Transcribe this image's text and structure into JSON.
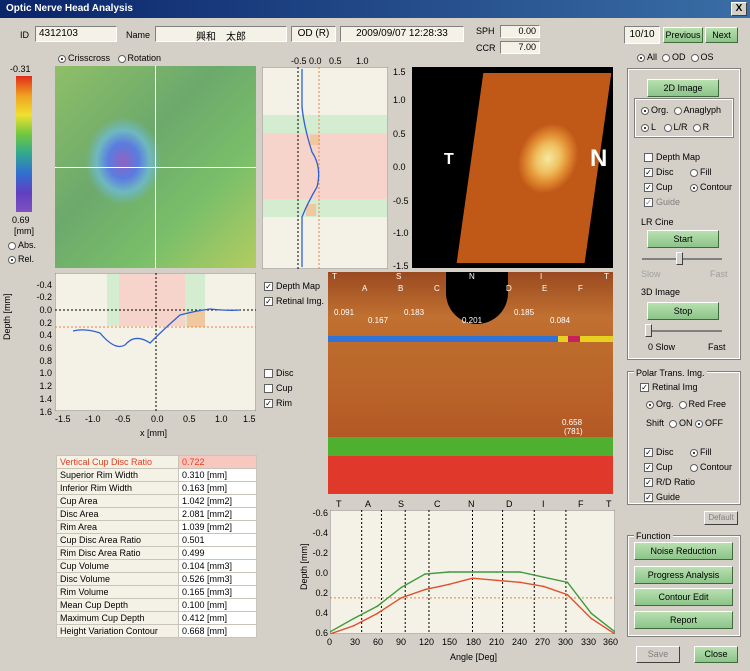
{
  "window": {
    "title": "Optic Nerve Head Analysis",
    "close_glyph": "X"
  },
  "header": {
    "id_label": "ID",
    "id_value": "4312103",
    "name_label": "Name",
    "name_value": "興和　太郎",
    "eye_value": "OD (R)",
    "datetime_value": "2009/09/07 12:28:33",
    "sph_label": "SPH",
    "sph_value": "0.00",
    "ccr_label": "CCR",
    "ccr_value": "7.00"
  },
  "nav": {
    "page_counter": "10/10",
    "previous_label": "Previous",
    "next_label": "Next",
    "filter_all": "All",
    "filter_od": "OD",
    "filter_os": "OS"
  },
  "view_mode": {
    "crisscross": "Crisscross",
    "rotation": "Rotation"
  },
  "colorbar": {
    "top": "-0.31",
    "bottom": "0.69",
    "unit": "[mm]",
    "abs": "Abs.",
    "rel": "Rel."
  },
  "vertical_profile": {
    "ticks_top": [
      "-0.5",
      "0.0",
      "0.5",
      "1.0"
    ],
    "ticks_right": [
      "1.5",
      "1.0",
      "0.5",
      "0.0",
      "-0.5",
      "-1.0",
      "-1.5"
    ]
  },
  "image_3d": {
    "label_t": "T",
    "label_n": "N"
  },
  "horizontal_profile": {
    "ylabel": "Depth [mm]",
    "xlabel": "x [mm]",
    "yticks": [
      "-0.4",
      "-0.2",
      "0.0",
      "0.2",
      "0.4",
      "0.6",
      "0.8",
      "1.0",
      "1.2",
      "1.4",
      "1.6"
    ],
    "xticks": [
      "-1.5",
      "-1.0",
      "-0.5",
      "0.0",
      "0.5",
      "1.0",
      "1.5"
    ]
  },
  "overlay_checks": {
    "depth_map": "Depth Map",
    "retinal_img": "Retinal Img.",
    "disc": "Disc",
    "cup": "Cup",
    "rim": "Rim"
  },
  "polar": {
    "sector_letters": [
      "T",
      "A",
      "S",
      "B",
      "C",
      "N",
      "D",
      "I",
      "E",
      "F",
      "T"
    ],
    "ratios": [
      "0.091",
      "0.167",
      "0.183",
      "0.201",
      "0.185",
      "0.084"
    ],
    "right_value": "0.658",
    "right_value2": "(781)"
  },
  "polar_chart": {
    "ylabel": "Depth [mm]",
    "xlabel": "Angle [Deg]",
    "yticks": [
      "-0.6",
      "-0.4",
      "-0.2",
      "0.0",
      "0.2",
      "0.4",
      "0.6"
    ],
    "xticks": [
      "0",
      "30",
      "60",
      "90",
      "120",
      "150",
      "180",
      "210",
      "240",
      "270",
      "300",
      "330",
      "360"
    ],
    "top_letters": [
      "T",
      "A",
      "S",
      "C",
      "N",
      "D",
      "I",
      "F",
      "T"
    ]
  },
  "measurements": [
    {
      "k": "Vertical Cup Disc Ratio",
      "v": "0.722",
      "hl": true
    },
    {
      "k": "Superior Rim Width",
      "v": "0.310 [mm]"
    },
    {
      "k": "Inferior Rim Width",
      "v": "0.163 [mm]"
    },
    {
      "k": "Cup Area",
      "v": "1.042 [mm2]"
    },
    {
      "k": "Disc Area",
      "v": "2.081 [mm2]"
    },
    {
      "k": "Rim Area",
      "v": "1.039 [mm2]"
    },
    {
      "k": "Cup Disc Area Ratio",
      "v": "0.501"
    },
    {
      "k": "Rim Disc Area Ratio",
      "v": "0.499"
    },
    {
      "k": "Cup Volume",
      "v": "0.104 [mm3]"
    },
    {
      "k": "Disc Volume",
      "v": "0.526 [mm3]"
    },
    {
      "k": "Rim Volume",
      "v": "0.165 [mm3]"
    },
    {
      "k": "Mean Cup Depth",
      "v": "0.100 [mm]"
    },
    {
      "k": "Maximum Cup Depth",
      "v": "0.412 [mm]"
    },
    {
      "k": "Height Variation Contour",
      "v": "0.668 [mm]"
    }
  ],
  "right_panel": {
    "btn_2d": "2D Image",
    "org": "Org.",
    "anaglyph": "Anaglyph",
    "l": "L",
    "lr": "L/R",
    "r": "R",
    "depth_map": "Depth Map",
    "disc": "Disc",
    "fill": "Fill",
    "cup": "Cup",
    "contour": "Contour",
    "guide": "Guide",
    "lr_cine": "LR Cine",
    "start": "Start",
    "slow": "Slow",
    "fast": "Fast",
    "image_3d": "3D Image",
    "stop": "Stop",
    "zero_slow": "0  Slow",
    "fast2": "Fast",
    "polar_trans": "Polar Trans. Img.",
    "retinal_img": "Retinal Img",
    "red_free": "Red Free",
    "shift": "Shift",
    "on": "ON",
    "off": "OFF",
    "rd_ratio": "R/D Ratio",
    "default": "Default",
    "function": "Function",
    "noise_reduction": "Noise Reduction",
    "progress_analysis": "Progress Analysis",
    "contour_edit": "Contour Edit",
    "report": "Report",
    "save": "Save",
    "close": "Close"
  },
  "chart_data": {
    "type": "line",
    "xlabel": "Angle [Deg]",
    "ylabel": "Depth [mm]",
    "ylim": [
      -0.6,
      0.6
    ],
    "xlim": [
      0,
      360
    ],
    "x": [
      0,
      30,
      60,
      90,
      120,
      150,
      180,
      210,
      240,
      270,
      300,
      330,
      360
    ],
    "series": [
      {
        "color": "#3f9b3f",
        "values": [
          0.58,
          0.45,
          0.33,
          0.15,
          0.02,
          0.0,
          0.0,
          0.0,
          0.0,
          0.05,
          0.1,
          0.4,
          0.58
        ]
      },
      {
        "color": "#e0502c",
        "values": [
          0.6,
          0.52,
          0.4,
          0.25,
          0.17,
          0.12,
          0.06,
          0.08,
          0.1,
          0.14,
          0.22,
          0.45,
          0.6
        ]
      }
    ]
  }
}
